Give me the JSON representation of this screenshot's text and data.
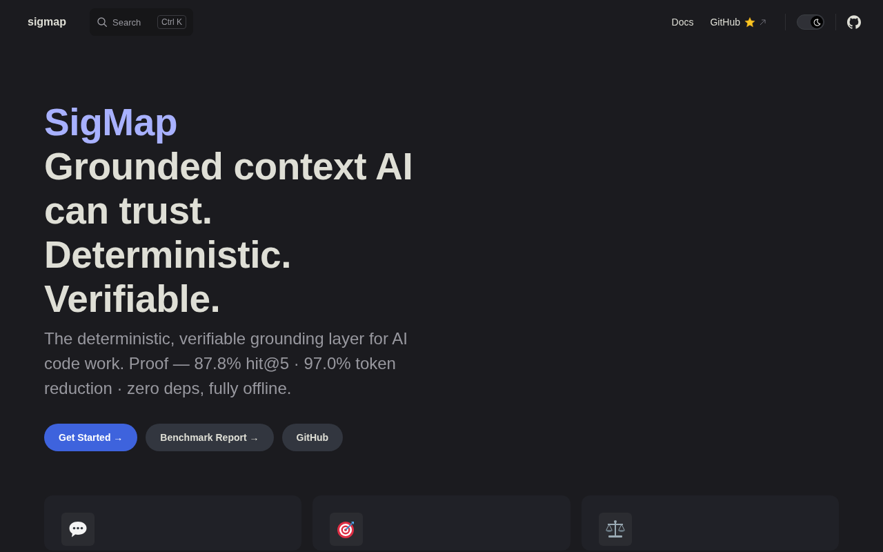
{
  "nav": {
    "logo": "sigmap",
    "search": {
      "placeholder": "Search",
      "shortcut": "Ctrl K"
    },
    "links": [
      {
        "label": "Docs",
        "kind": "internal",
        "starred": false
      },
      {
        "label": "GitHub",
        "kind": "external",
        "starred": true
      }
    ],
    "theme_toggle": {
      "dark": true
    }
  },
  "hero": {
    "name": "SigMap",
    "text": "Grounded context AI can trust. Deterministic. Verifiable.",
    "tagline": "The deterministic, verifiable grounding layer for AI code work. Proof — 87.8% hit@5 · 97.0% token reduction · zero deps, fully offline.",
    "actions": [
      {
        "label": "Get Started →",
        "kind": "brand"
      },
      {
        "label": "Benchmark Report →",
        "kind": "alt"
      },
      {
        "label": "GitHub",
        "kind": "alt"
      }
    ]
  },
  "features": [
    {
      "kind": "speech"
    },
    {
      "kind": "target"
    },
    {
      "kind": "scales"
    }
  ]
}
